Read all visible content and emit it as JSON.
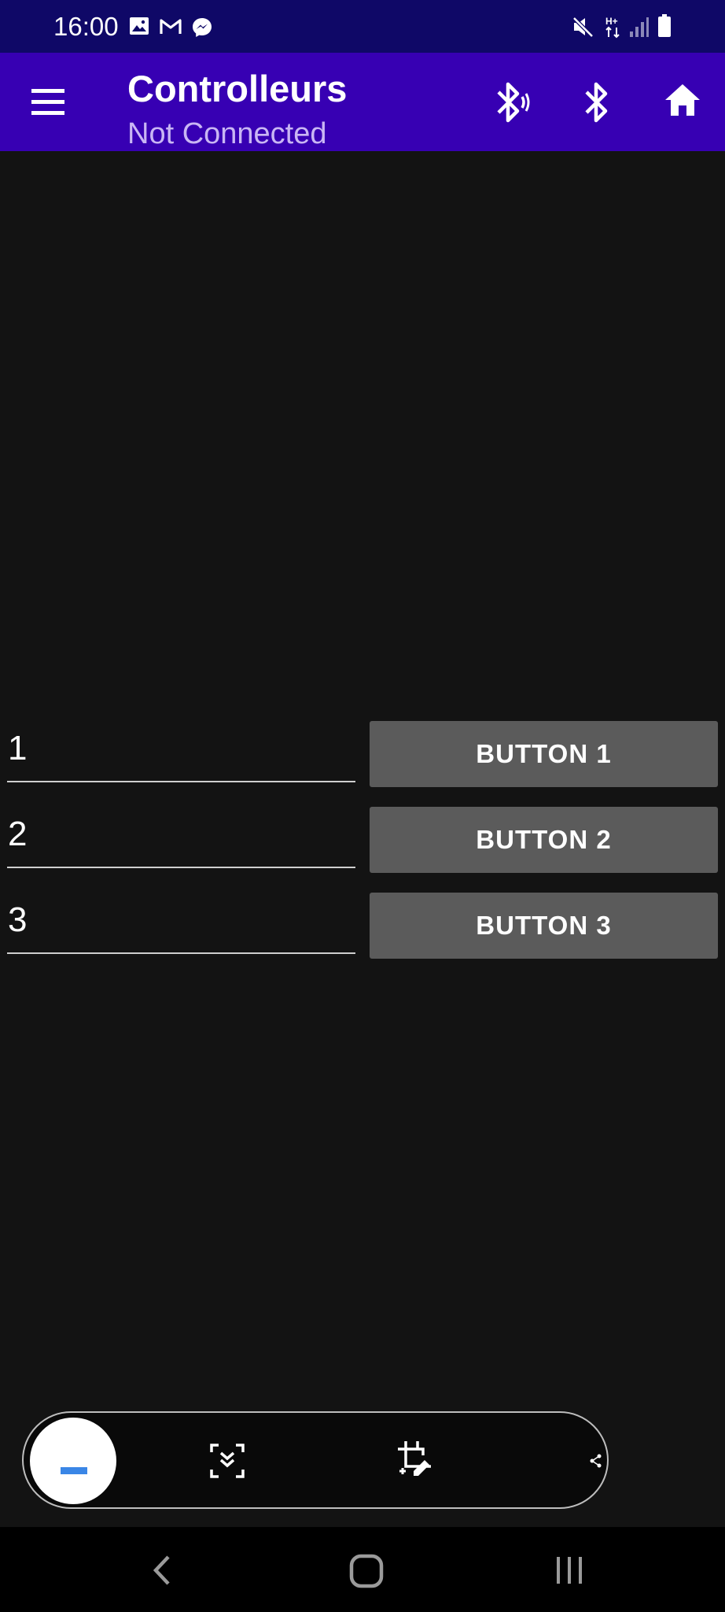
{
  "status_bar": {
    "time": "16:00",
    "left_icons": [
      "image-icon",
      "gmail-icon",
      "messenger-icon"
    ],
    "right_icons": [
      "mute-icon",
      "hplus-data-icon",
      "signal-icon",
      "battery-icon"
    ]
  },
  "app_bar": {
    "title": "Controlleurs",
    "subtitle": "Not Connected",
    "actions": [
      "bluetooth-scan-icon",
      "bluetooth-icon",
      "home-icon"
    ],
    "background": "#3700b3",
    "subtitle_color": "#c9b6f4"
  },
  "rows": [
    {
      "input_value": "1",
      "button_label": "BUTTON 1"
    },
    {
      "input_value": "2",
      "button_label": "BUTTON 2"
    },
    {
      "input_value": "3",
      "button_label": "BUTTON 3"
    }
  ],
  "screenshot_toolbar": {
    "items": [
      "preview-thumbnail",
      "scroll-capture-icon",
      "crop-edit-icon",
      "share-icon"
    ]
  },
  "nav_bar": {
    "items": [
      "back-icon",
      "home-icon",
      "recents-icon"
    ]
  }
}
